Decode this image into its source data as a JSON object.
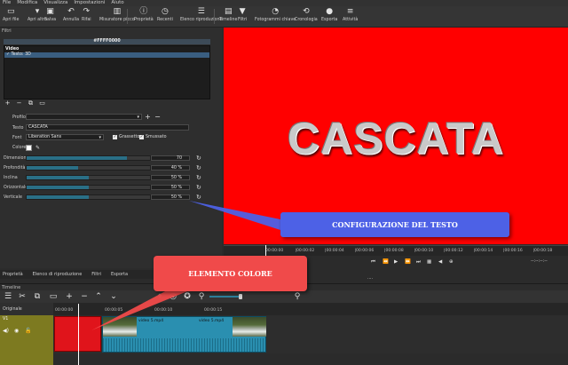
{
  "menu": [
    "File",
    "Modifica",
    "Visualizza",
    "Impostazioni",
    "Aiuto"
  ],
  "toolbar": [
    {
      "label": "Apri file",
      "icon": "folder-open-icon",
      "glyph": "▭"
    },
    {
      "label": "Apri altro",
      "icon": "open-other-icon",
      "glyph": "▾"
    },
    {
      "label": "Salva",
      "icon": "save-icon",
      "glyph": "▣"
    },
    {
      "label": "Annulla",
      "icon": "undo-icon",
      "glyph": "↶"
    },
    {
      "label": "Rifai",
      "icon": "redo-icon",
      "glyph": "↷"
    },
    {
      "label": "Misuratore picco",
      "icon": "peak-meter-icon",
      "glyph": "▥"
    },
    {
      "label": "Proprietà",
      "icon": "properties-icon",
      "glyph": "ⓘ"
    },
    {
      "label": "Recenti",
      "icon": "recent-icon",
      "glyph": "◷"
    },
    {
      "label": "Elenco riproduzione",
      "icon": "playlist-icon",
      "glyph": "☰"
    },
    {
      "label": "Timeline",
      "icon": "timeline-icon",
      "glyph": "▤"
    },
    {
      "label": "Filtri",
      "icon": "filter-icon",
      "glyph": "▼"
    },
    {
      "label": "Fotogrammi chiave",
      "icon": "keyframes-icon",
      "glyph": "◔"
    },
    {
      "label": "Cronologia",
      "icon": "history-icon",
      "glyph": "⟲"
    },
    {
      "label": "Esporta",
      "icon": "export-icon",
      "glyph": "●"
    },
    {
      "label": "Attività",
      "icon": "jobs-icon",
      "glyph": "≡"
    }
  ],
  "filters": {
    "title": "Filtri",
    "hex": "#FFFF0000",
    "category": "Video",
    "item": "✓ Testo: 3D",
    "profile_label": "Profilo",
    "text_label": "Testo",
    "text_value": "CASCATA",
    "font_label": "Font",
    "font_value": "Liberation Sans",
    "bold_label": "Grassetto",
    "smooth_label": "Smussato",
    "color_label": "Colore",
    "sliders": [
      {
        "label": "Dimensione",
        "value": "70",
        "fill": 0.81
      },
      {
        "label": "Profondità",
        "value": "40 %",
        "fill": 0.42
      },
      {
        "label": "Inclina",
        "value": "50 %",
        "fill": 0.5
      },
      {
        "label": "Orizzontale",
        "value": "50 %",
        "fill": 0.5
      },
      {
        "label": "Verticale",
        "value": "50 %",
        "fill": 0.5
      }
    ]
  },
  "bottom_tabs": [
    "Proprietà",
    "Elenco di riproduzione",
    "Filtri",
    "Esporta"
  ],
  "preview": {
    "text": "CASCATA",
    "bg": "#ff0000"
  },
  "ruler_ticks": [
    "00:00:00",
    "|00:00:02",
    "|00:00:04",
    "|00:00:06",
    "|00:00:08",
    "|00:00:10",
    "|00:00:12",
    "|00:00:14",
    "|00:00:16",
    "|00:00:18"
  ],
  "transport": {
    "timecode_left": "00:00:00:00",
    "timecode_right": "--:--:--:--",
    "dots": "...."
  },
  "timeline": {
    "title": "Timeline",
    "header": "Originale",
    "track_name": "V1",
    "ticks": [
      "00:00:00",
      "00:00:05",
      "00:00:10",
      "00:00:15"
    ],
    "clips": {
      "color_name": "#FFFF0000",
      "video_a": "video 5.mp4",
      "video_b": "video 5.mp4"
    }
  },
  "callouts": {
    "blue": "CONFIGURAZIONE DEL TESTO",
    "red": "ELEMENTO COLORE"
  },
  "colors": {
    "accent_blue": "#4d61e6",
    "accent_red": "#f04a4a",
    "track": "#7d7a20",
    "clip_video": "#2a8fb0"
  }
}
